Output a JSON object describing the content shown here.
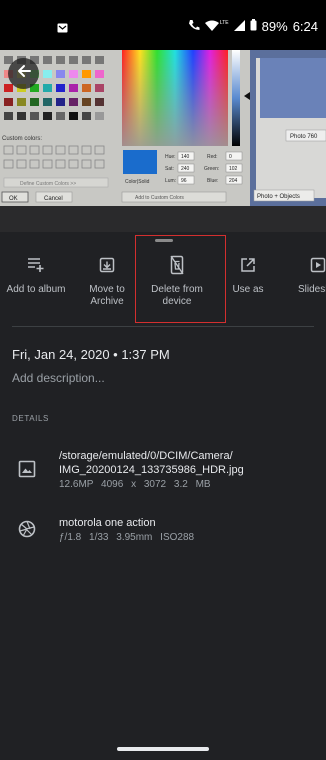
{
  "status": {
    "battery": "89%",
    "time": "6:24",
    "lte": "LTE"
  },
  "actions": [
    {
      "label": "Add to album",
      "icon": "add-to-album-icon"
    },
    {
      "label": "Move to\nArchive",
      "icon": "archive-icon"
    },
    {
      "label": "Delete from\ndevice",
      "icon": "delete-from-device-icon"
    },
    {
      "label": "Use as",
      "icon": "open-external-icon"
    },
    {
      "label": "Slidesh",
      "icon": "slideshow-icon"
    }
  ],
  "info": {
    "date": "Fri, Jan 24, 2020  •  1:37 PM",
    "description_placeholder": "Add description..."
  },
  "details": {
    "heading": "DETAILS",
    "file": {
      "path_line1": "/storage/emulated/0/DCIM/Camera/",
      "path_line2": "IMG_20200124_133735986_HDR.jpg",
      "meta": "12.6MP   4096 x 3072   3.2 MB"
    },
    "camera": {
      "model": "motorola one action",
      "meta": "ƒ/1.8   1/33   3.95mm   ISO288"
    }
  },
  "photo": {
    "custom_colors": "Custom colors:",
    "define_custom": "Define Custom Colors >>",
    "ok": "OK",
    "cancel": "Cancel",
    "color_solid": "Color|Solid",
    "hue_label": "Hue:",
    "hue": "140",
    "sat_label": "Sat:",
    "sat": "240",
    "lum_label": "Lum:",
    "lum": "96",
    "red_label": "Red:",
    "red": "0",
    "green_label": "Green:",
    "green": "102",
    "blue_label": "Blue:",
    "blue": "204",
    "add_custom": "Add to Custom Colors",
    "photo_label": "Photo 760",
    "photo_objects": "Photo + Objects"
  }
}
